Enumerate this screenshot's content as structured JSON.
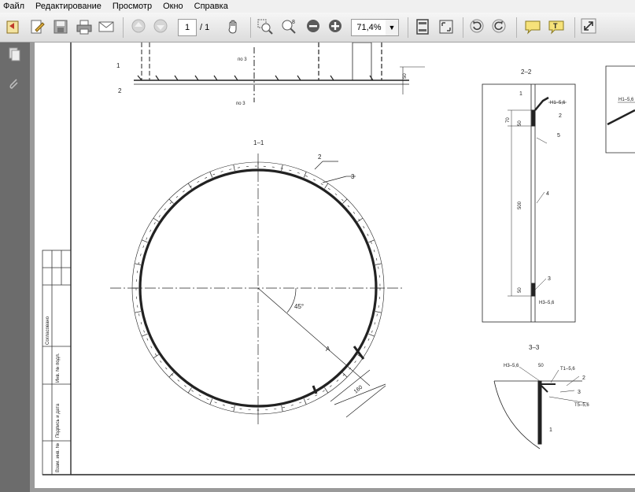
{
  "menu": [
    "Файл",
    "Редактирование",
    "Просмотр",
    "Окно",
    "Справка"
  ],
  "toolbar": {
    "page_current": "1",
    "page_total": "/ 1",
    "zoom": "71,4%"
  },
  "drawing": {
    "section_1": "1–1",
    "section_2": "2–2",
    "section_3": "3–3",
    "labels": {
      "l1": "1",
      "l2": "2",
      "l3": "3",
      "l4": "4",
      "l5": "5",
      "angle": "45°",
      "dim_a": "А",
      "dim_160": "160",
      "dim_50": "50",
      "dim_70": "70",
      "dim_500": "500",
      "weld_h1": "Н1–5,6",
      "weld_h3": "Н3–5,6",
      "weld_t1": "Т1–5,6",
      "weld_t5": "Т5–5,6",
      "weld_note": "по 3"
    },
    "stamp_labels": [
      "Согласовано",
      "Инв. № подл.",
      "Подпись и дата",
      "Взам. инв. №"
    ]
  },
  "colors": {
    "toolbar_bg": "#e6e6e6",
    "sidebar_bg": "#6c6c6c",
    "doc_bg": "#9a9a9a"
  }
}
